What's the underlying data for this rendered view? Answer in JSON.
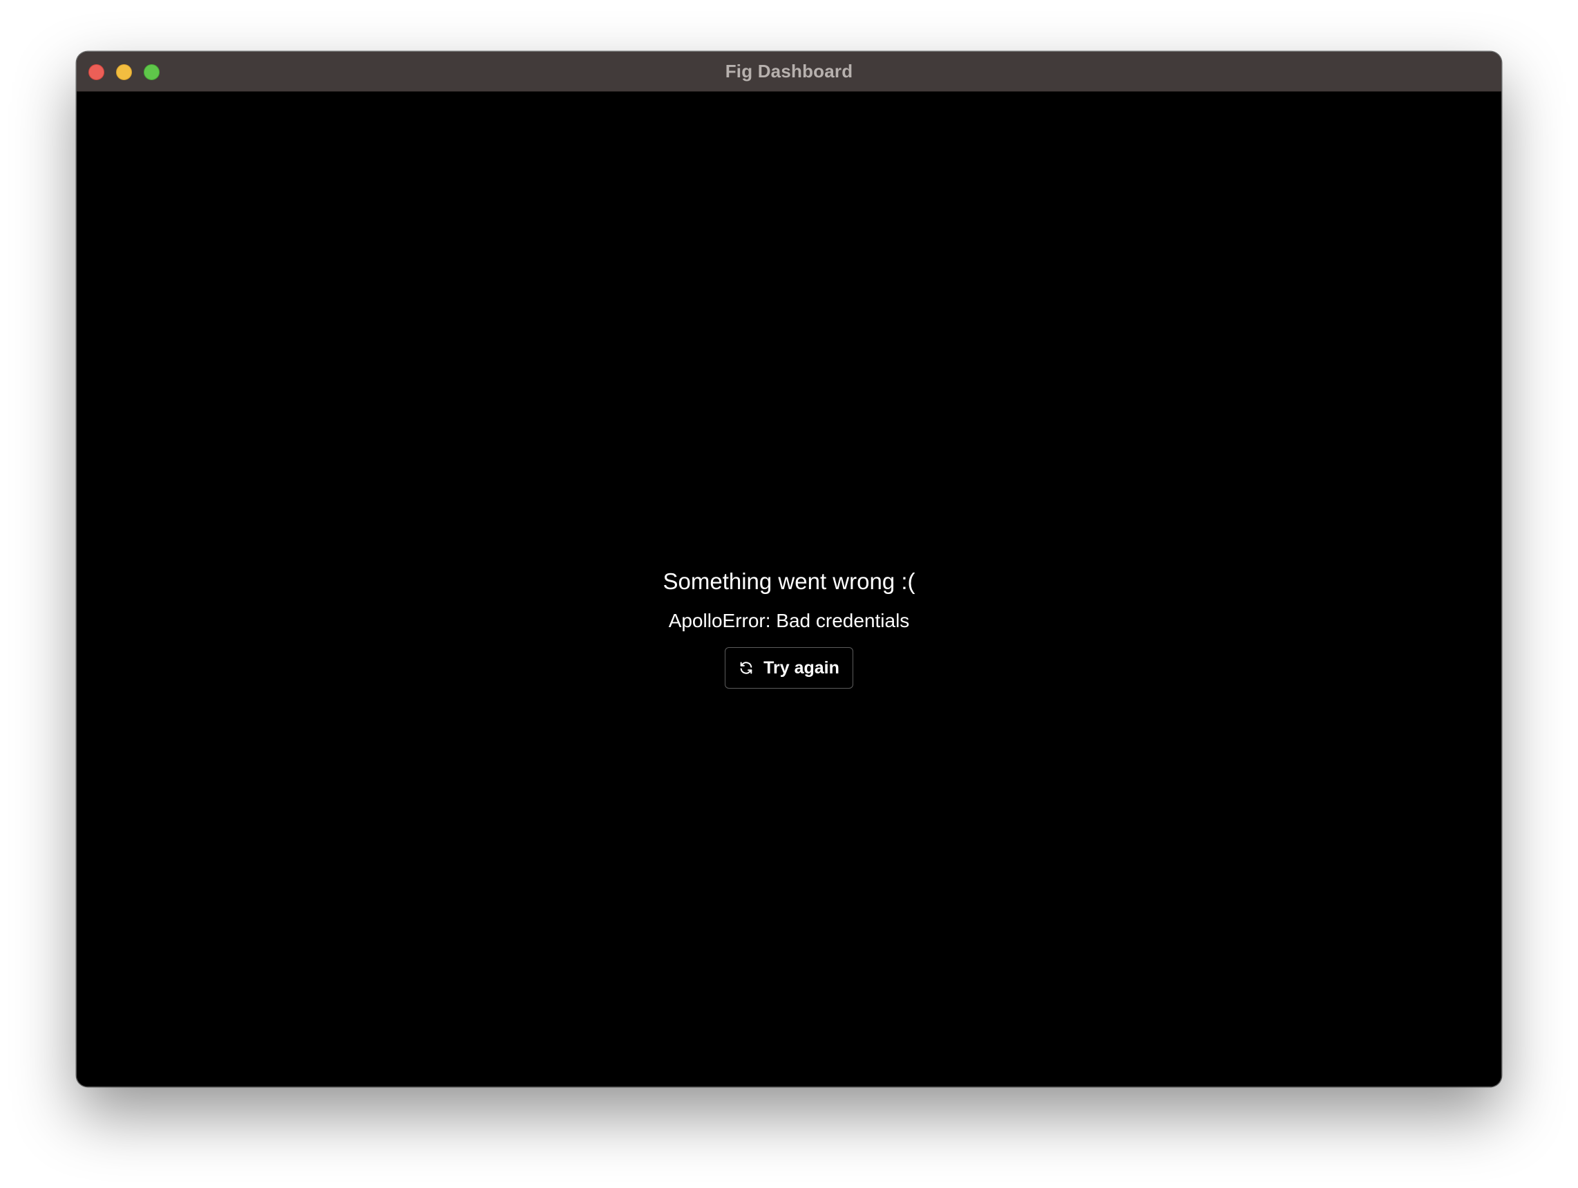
{
  "window": {
    "title": "Fig Dashboard"
  },
  "error": {
    "heading": "Something went wrong :(",
    "message": "ApolloError: Bad credentials",
    "retry_label": "Try again",
    "retry_icon": "refresh-icon"
  },
  "colors": {
    "titlebar": "#423b3a",
    "content_background": "#000000",
    "text": "#ffffff",
    "close": "#ec5f57",
    "minimize": "#f2bd40",
    "zoom": "#5fc64a"
  }
}
